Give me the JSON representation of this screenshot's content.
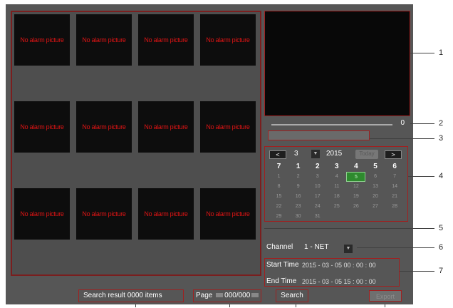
{
  "thumbnails": [
    "No alarm picture",
    "No alarm picture",
    "No alarm picture",
    "No alarm picture",
    "No alarm picture",
    "No alarm picture",
    "No alarm picture",
    "No alarm picture",
    "No alarm picture",
    "No alarm picture",
    "No alarm picture",
    "No alarm picture"
  ],
  "slider": {
    "value": "0"
  },
  "calendar": {
    "prev_label": "<",
    "next_label": ">",
    "month": "3",
    "year": "2015",
    "today_label": "Today",
    "weekdays": [
      "7",
      "1",
      "2",
      "3",
      "4",
      "5",
      "6"
    ],
    "weeks": [
      [
        "1",
        "2",
        "3",
        "4",
        "5",
        "6",
        "7"
      ],
      [
        "8",
        "9",
        "10",
        "11",
        "12",
        "13",
        "14"
      ],
      [
        "15",
        "16",
        "17",
        "18",
        "19",
        "20",
        "21"
      ],
      [
        "22",
        "23",
        "24",
        "25",
        "26",
        "27",
        "28"
      ],
      [
        "29",
        "30",
        "31",
        "",
        "",
        "",
        ""
      ]
    ],
    "selected_day": "5"
  },
  "channel": {
    "label": "Channel",
    "value": "1 - NET"
  },
  "time": {
    "start_label": "Start Time",
    "start_value": "2015 - 03 - 05    00 : 00 : 00",
    "end_label": "End Time",
    "end_value": "2015 - 03 - 05    15 : 00 : 00"
  },
  "bottom": {
    "search_result": "Search result  0000 items",
    "page_label": "Page",
    "page_value": "000/000",
    "search_button": "Search",
    "export_button": "Export"
  },
  "callouts": [
    "1",
    "2",
    "3",
    "4",
    "5",
    "6",
    "7"
  ],
  "colors": {
    "panel": "#565656",
    "highlight": "#a02020",
    "alarm_text": "#e01414",
    "selected_day": "#2e8a2e"
  }
}
